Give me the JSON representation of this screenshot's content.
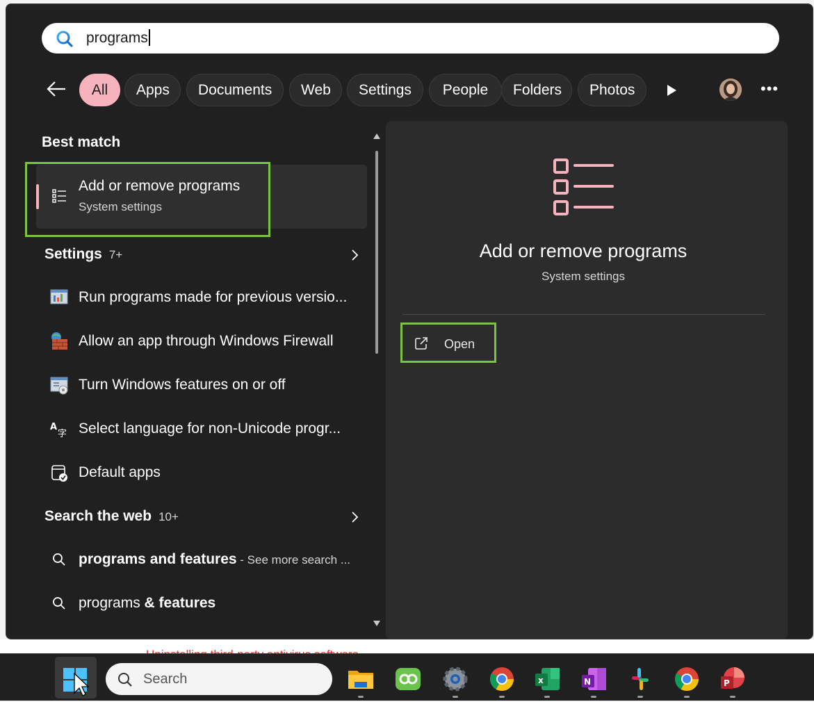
{
  "search": {
    "value": "programs"
  },
  "filters": [
    "All",
    "Apps",
    "Documents",
    "Web",
    "Settings",
    "People",
    "Folders",
    "Photos"
  ],
  "sections": {
    "best_match": "Best match",
    "settings": "Settings",
    "settings_count": "7+",
    "web": "Search the web",
    "web_count": "10+"
  },
  "best_match": {
    "title": "Add or remove programs",
    "subtitle": "System settings"
  },
  "settings_items": [
    "Run programs made for previous versio...",
    "Allow an app through Windows Firewall",
    "Turn Windows features on or off",
    "Select language for non-Unicode progr...",
    "Default apps"
  ],
  "web_items": [
    {
      "bold": "programs and features",
      "suffix": " - See more search ..."
    },
    {
      "bold_prefix": "programs",
      "bold_suffix": " & features"
    }
  ],
  "detail": {
    "title": "Add or remove programs",
    "subtitle": "System settings",
    "open_label": "Open"
  },
  "taskbar": {
    "search_placeholder": "Search"
  },
  "background": {
    "partial_text": "Uninstalling third-party antivirus software"
  },
  "colors": {
    "accent": "#f7b3bd",
    "highlight": "#7dc243",
    "panel": "#202020",
    "pane": "#2c2c2c"
  }
}
